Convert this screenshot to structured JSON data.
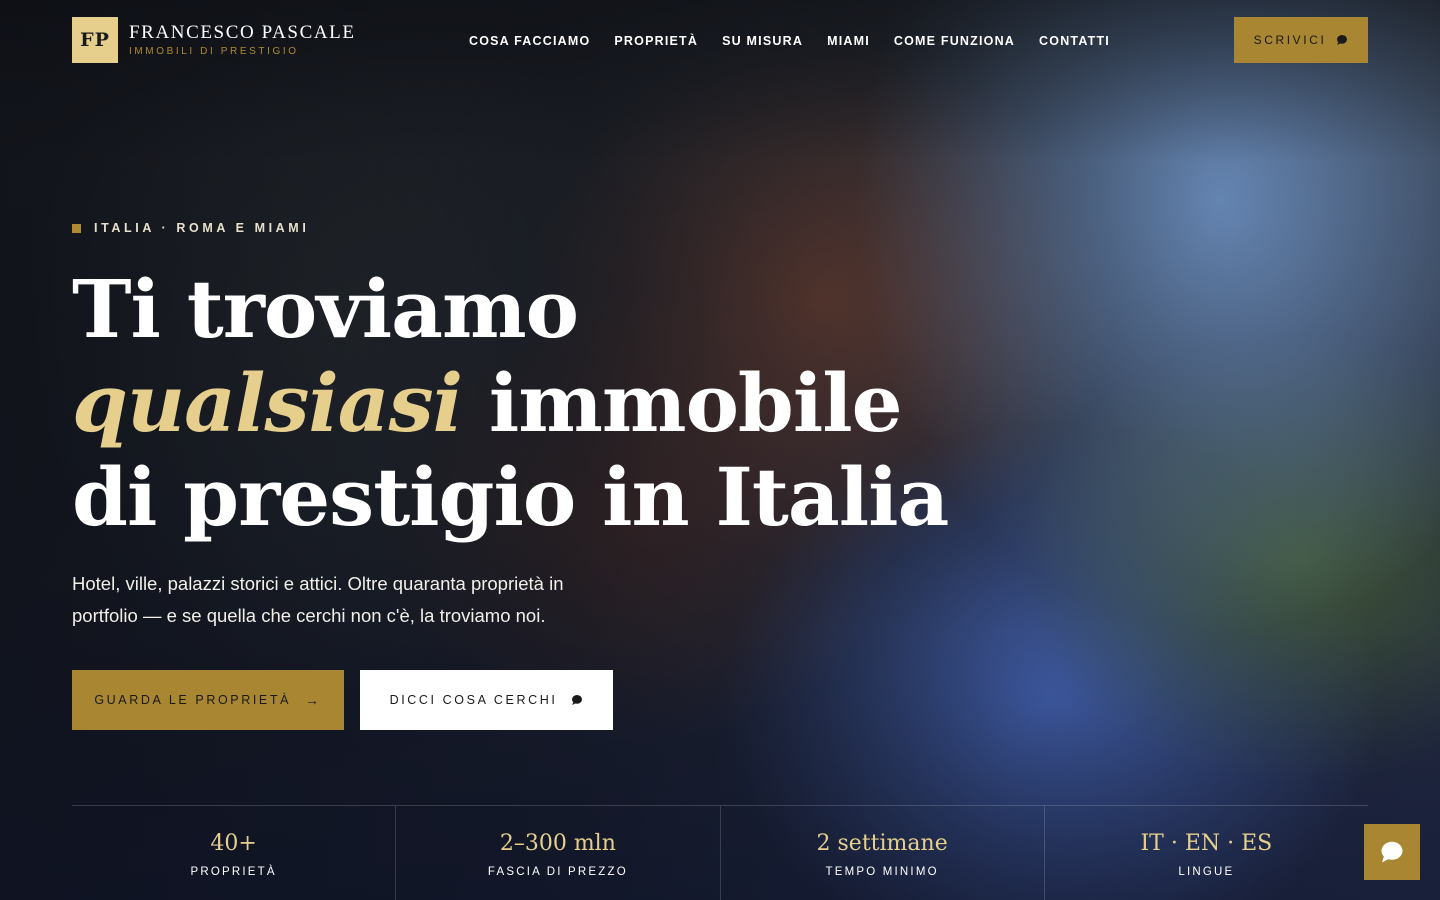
{
  "brand": {
    "monogram": "FP",
    "name": "FRANCESCO PASCALE",
    "tagline": "IMMOBILI DI PRESTIGIO"
  },
  "nav": {
    "items": [
      {
        "label": "COSA FACCIAMO"
      },
      {
        "label": "PROPRIETÀ"
      },
      {
        "label": "SU MISURA"
      },
      {
        "label": "MIAMI"
      },
      {
        "label": "COME FUNZIONA"
      },
      {
        "label": "CONTATTI"
      }
    ],
    "cta_label": "SCRIVICI",
    "cta_icon": "chat-bubble-icon"
  },
  "hero": {
    "eyebrow": "ITALIA · ROMA E MIAMI",
    "headline_line1": "Ti troviamo",
    "headline_accent": "qualsiasi",
    "headline_line2_rest": " immobile",
    "headline_line3": "di prestigio in Italia",
    "subtitle": "Hotel, ville, palazzi storici e attici. Oltre quaranta proprietà in portfolio — e se quella che cerchi non c'è, la troviamo noi.",
    "primary_button": "GUARDA LE PROPRIETÀ",
    "primary_icon": "arrow-right-icon",
    "secondary_button": "DICCI COSA CERCHI",
    "secondary_icon": "chat-bubble-icon"
  },
  "stats": [
    {
      "value": "40+",
      "label": "PROPRIETÀ"
    },
    {
      "value": "2–300 mln",
      "label": "FASCIA DI PREZZO"
    },
    {
      "value": "2 settimane",
      "label": "TEMPO MINIMO"
    },
    {
      "value": "IT · EN · ES",
      "label": "LINGUE"
    }
  ],
  "colors": {
    "accent_gold": "#a88632",
    "accent_light_gold": "#e6cf8d",
    "button_light": "#ffffff"
  },
  "chat_fab_icon": "chat-bubble-icon"
}
